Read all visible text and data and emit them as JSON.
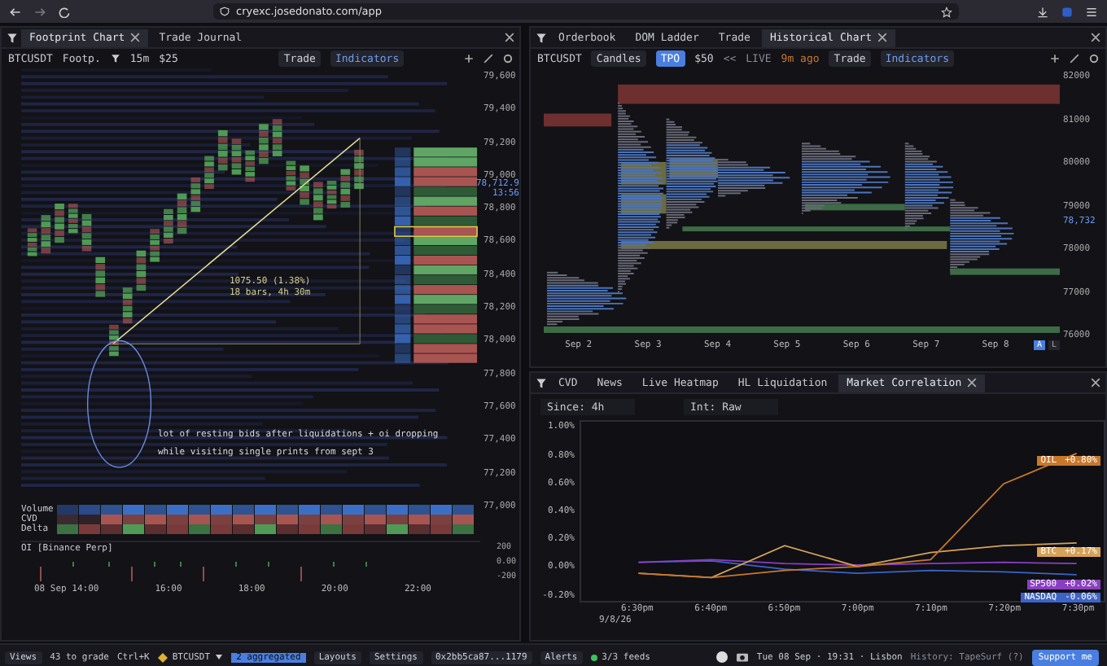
{
  "browser": {
    "url": "cryexc.josedonato.com/app"
  },
  "footprint_panel": {
    "tabs": [
      {
        "label": "Footprint Chart",
        "selected": true
      },
      {
        "label": "Trade Journal",
        "selected": false
      }
    ],
    "toolbar": {
      "symbol": "BTCUSDT",
      "chart_type": "Footp.",
      "timeframe": "15m",
      "tick_size": "$25",
      "buttons": [
        {
          "label": "Trade",
          "selected": false
        },
        {
          "label": "Indicators",
          "selected": true
        }
      ]
    },
    "price_axis": [
      "79,600",
      "79,400",
      "79,200",
      "79,000",
      "78,800",
      "78,600",
      "78,400",
      "78,200",
      "78,000",
      "77,800",
      "77,600",
      "77,400",
      "77,200",
      "77,000"
    ],
    "current_price": "78,712.9",
    "countdown": "13:56",
    "measurement": [
      "1075.50 (1.38%)",
      "18 bars, 4h 30m"
    ],
    "note": [
      "lot of resting bids after liquidations + oi dropping",
      "while visiting single prints from sept 3"
    ],
    "indicator_rows": [
      "Volume",
      "CVD",
      "Delta"
    ],
    "oi_pane": {
      "title": "OI [Binance Perp]",
      "axis": [
        "200",
        "0.00",
        "-200"
      ]
    },
    "time_axis": [
      "08 Sep 14:00",
      "16:00",
      "18:00",
      "20:00",
      "22:00"
    ]
  },
  "historical_panel": {
    "tabs": [
      {
        "label": "Orderbook",
        "selected": false
      },
      {
        "label": "DOM Ladder",
        "selected": false
      },
      {
        "label": "Trade",
        "selected": false
      },
      {
        "label": "Historical Chart",
        "selected": true
      }
    ],
    "toolbar": {
      "symbol": "BTCUSDT",
      "modes": [
        {
          "label": "Candles",
          "selected": false
        },
        {
          "label": "TPO",
          "selected": true
        }
      ],
      "tick_size": "$50",
      "nav": "<<",
      "live": "LIVE",
      "updated": "9m ago",
      "buttons": [
        {
          "label": "Trade",
          "selected": false
        },
        {
          "label": "Indicators",
          "selected": true
        }
      ]
    },
    "price_axis": [
      "82000",
      "81000",
      "80000",
      "79000",
      "78000",
      "77000",
      "76000"
    ],
    "current_price": "78,732",
    "date_axis": [
      "Sep 2",
      "Sep 3",
      "Sep 4",
      "Sep 5",
      "Sep 6",
      "Sep 7",
      "Sep 8"
    ],
    "scale_buttons": [
      {
        "label": "A",
        "selected": true
      },
      {
        "label": "L",
        "selected": false
      }
    ]
  },
  "correlation_panel": {
    "tabs": [
      {
        "label": "CVD",
        "selected": false
      },
      {
        "label": "News",
        "selected": false
      },
      {
        "label": "Live Heatmap",
        "selected": false
      },
      {
        "label": "HL Liquidation",
        "selected": false
      },
      {
        "label": "Market Correlation",
        "selected": true
      }
    ],
    "filters": [
      "Since: 4h",
      "Int: Raw"
    ],
    "chart_data": {
      "type": "line",
      "categories": [
        "6:30pm",
        "6:40pm",
        "6:50pm",
        "7:00pm",
        "7:10pm",
        "7:20pm",
        "7:30pm"
      ],
      "ylim": [
        -0.25,
        1.05
      ],
      "yticks": [
        {
          "value": 1,
          "label": "1.00%"
        },
        {
          "value": 0.8,
          "label": "0.80%"
        },
        {
          "value": 0.6,
          "label": "0.60%"
        },
        {
          "value": 0.4,
          "label": "0.40%"
        },
        {
          "value": 0.2,
          "label": "0.20%"
        },
        {
          "value": 0,
          "label": "0.00%"
        },
        {
          "value": -0.2,
          "label": "-0.20%"
        }
      ],
      "series": [
        {
          "name": "OIL",
          "color": "#c8782c",
          "values": [
            -0.05,
            -0.08,
            -0.03,
            0,
            0.05,
            0.6,
            0.82
          ]
        },
        {
          "name": "BTC",
          "color": "#d6a257",
          "values": [
            -0.05,
            -0.08,
            0.15,
            0,
            0.1,
            0.15,
            0.17
          ]
        },
        {
          "name": "SP500",
          "color": "#8a3fc0",
          "values": [
            0.03,
            0.05,
            0.02,
            0.01,
            0.02,
            0.03,
            0.02
          ]
        },
        {
          "name": "NASDAQ",
          "color": "#3c64c8",
          "values": [
            0.03,
            0.04,
            -0.02,
            -0.05,
            -0.03,
            -0.04,
            -0.06
          ]
        }
      ]
    },
    "date": "9/8/26",
    "changes": [
      "+0.80%",
      "+0.17%",
      "+0.02%",
      "-0.06%"
    ]
  },
  "status_bar": {
    "views": "Views",
    "grading": "43 to grade",
    "shortcut": "Ctrl+K",
    "symbol": "BTCUSDT",
    "aggregated": "2 aggregated",
    "buttons": [
      "Layouts",
      "Settings"
    ],
    "wallet": "0x2bb5ca87...1179",
    "alerts": "Alerts",
    "feeds": "3/3 feeds",
    "datetime": "Tue 08 Sep · 19:31 · Lisbon",
    "history": "History: TapeSurf (?)",
    "support": "Support me"
  }
}
